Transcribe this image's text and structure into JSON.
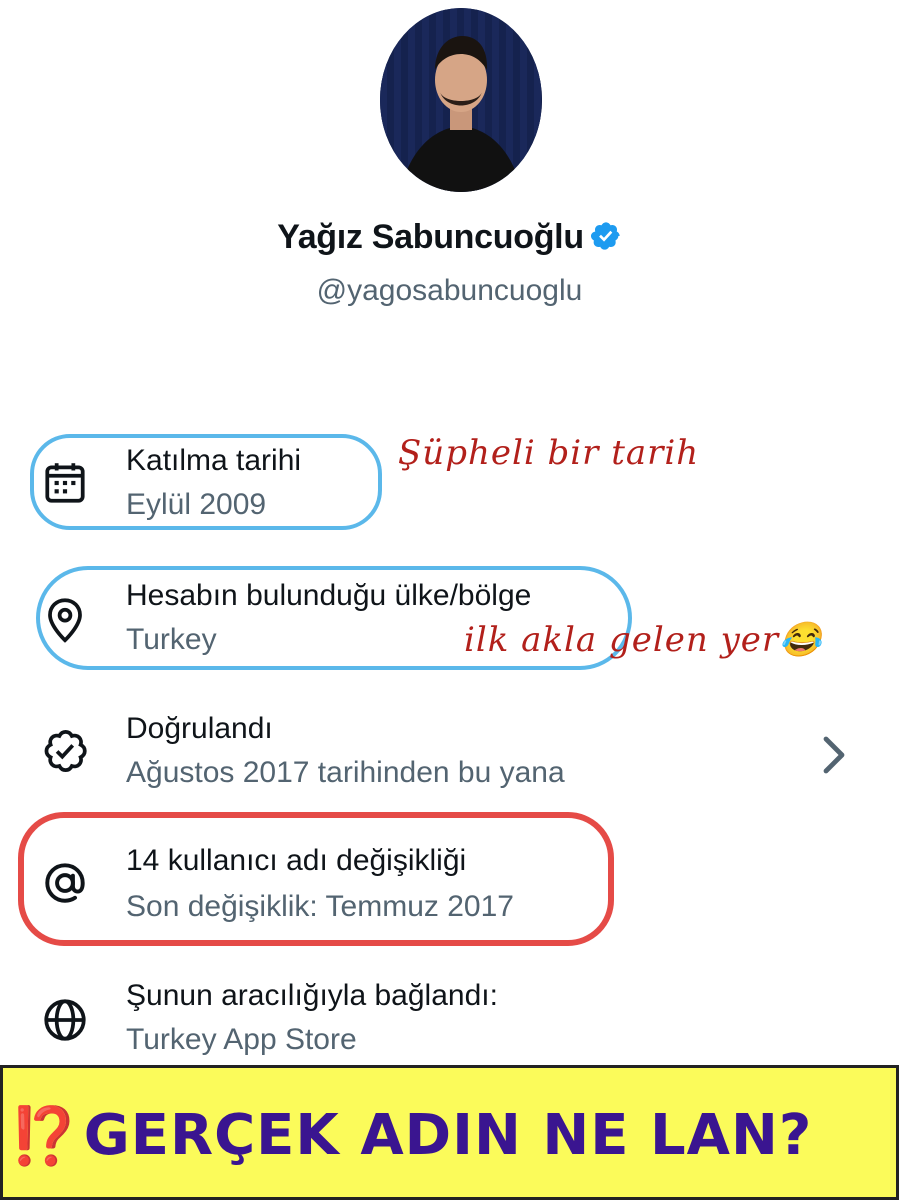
{
  "profile": {
    "display_name": "Yağız Sabuncuoğlu",
    "handle": "@yagosabuncuoglu",
    "verified_color": "#1d9bf0"
  },
  "rows": [
    {
      "icon": "calendar-icon",
      "title": "Katılma tarihi",
      "subtitle": "Eylül 2009"
    },
    {
      "icon": "location-pin-icon",
      "title": "Hesabın bulunduğu ülke/bölge",
      "subtitle": "Turkey"
    },
    {
      "icon": "verified-badge-icon",
      "title": "Doğrulandı",
      "subtitle": "Ağustos 2017 tarihinden bu yana"
    },
    {
      "icon": "at-sign-icon",
      "title": "14 kullanıcı adı değişikliği",
      "subtitle": "Son değişiklik: Temmuz 2017"
    },
    {
      "icon": "globe-icon",
      "title": "Şunun aracılığıyla bağlandı:",
      "subtitle": "Turkey App Store"
    }
  ],
  "annotations": {
    "note_1": "Şüpheli bir tarih",
    "note_2": "ilk akla gelen yer😂",
    "ring_blue_color": "#5bb8ea",
    "ring_red_color": "#e54b47",
    "note_color": "#b2201b"
  },
  "banner": {
    "marks": "⁉️",
    "text": "GERÇEK ADIN NE LAN?",
    "background": "#fbfb5a",
    "text_color": "#3a1590"
  }
}
